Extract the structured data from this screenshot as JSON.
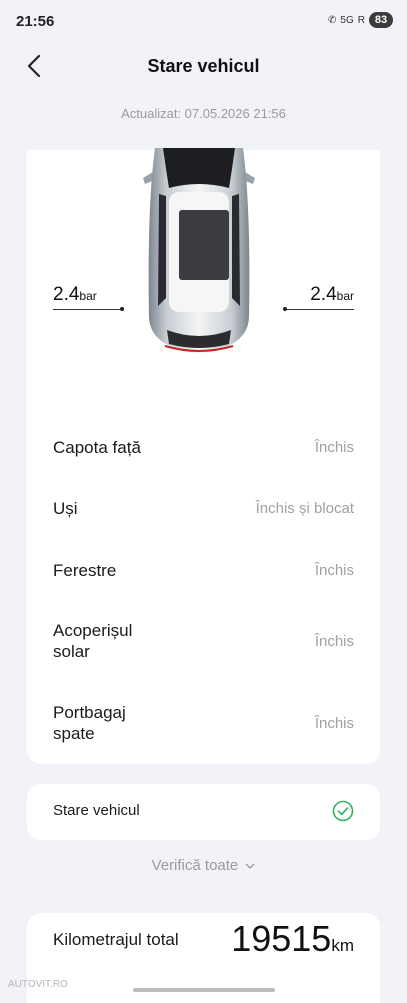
{
  "status_bar": {
    "time": "21:56",
    "network": "5G",
    "signal": "R",
    "battery": "83"
  },
  "header": {
    "title": "Stare vehicul"
  },
  "updated": "Actualizat: 07.05.2026 21:56",
  "tires": {
    "left": {
      "value": "2.4",
      "unit": "bar"
    },
    "right": {
      "value": "2.4",
      "unit": "bar"
    }
  },
  "rows": [
    {
      "label": "Capota față",
      "value": "Închis"
    },
    {
      "label": "Uși",
      "value": "Închis și blocat"
    },
    {
      "label": "Ferestre",
      "value": "Închis"
    },
    {
      "label": "Acoperișul solar",
      "value": "Închis"
    },
    {
      "label": "Portbagaj spate",
      "value": "Închis"
    }
  ],
  "vehicle_status": {
    "label": "Stare vehicul",
    "icon": "check-circle-icon",
    "accent": "#2fb35a"
  },
  "verify_all": "Verifică toate",
  "odometer": {
    "label": "Kilometrajul total",
    "value": "19515",
    "unit": "km"
  },
  "watermark": "AUTOVIT.RO"
}
